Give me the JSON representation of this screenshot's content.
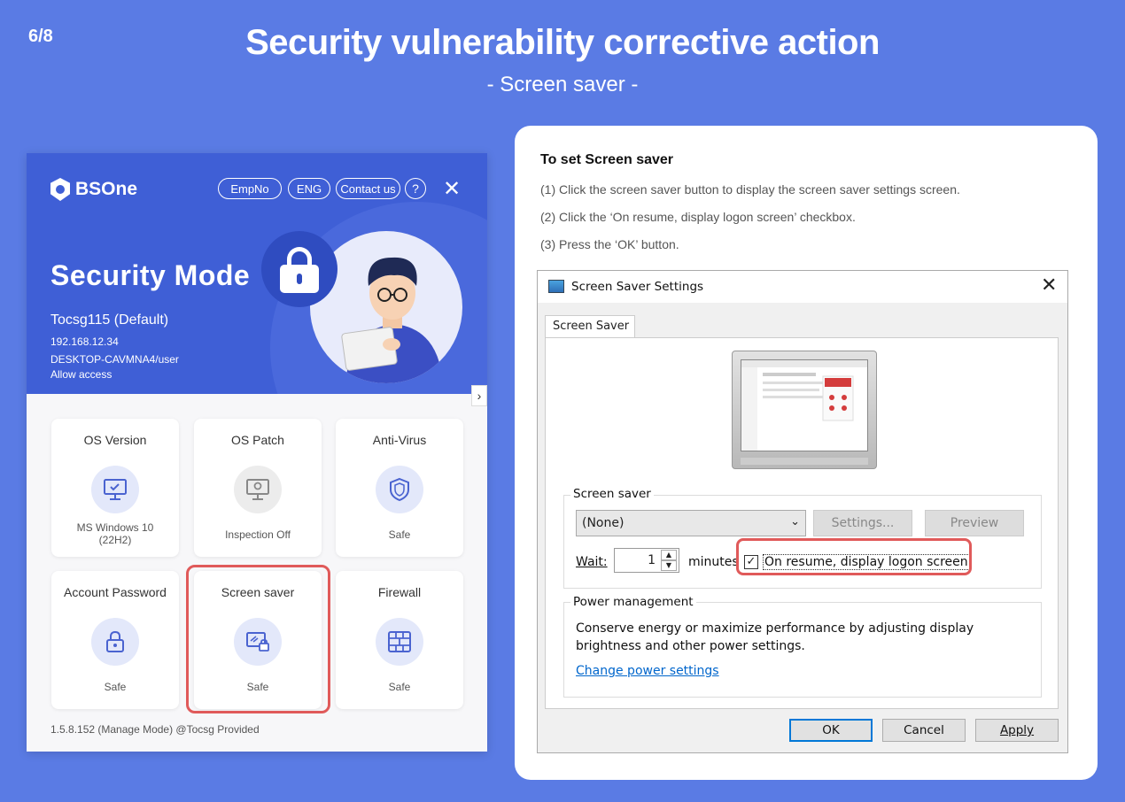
{
  "slide": {
    "page": "6/8",
    "title": "Security vulnerability corrective action",
    "subtitle": "- Screen saver -"
  },
  "app": {
    "brand": "BSOne",
    "header_buttons": [
      "EmpNo",
      "ENG",
      "Contact us"
    ],
    "help_label": "?",
    "close_label": "✕",
    "mode_title": "Security Mode",
    "user": "Tocsg115 (Default)",
    "ip": "192.168.12.34",
    "host": "DESKTOP-CAVMNA4/user",
    "access": "Allow access",
    "expand_label": "›",
    "cards": [
      {
        "title": "OS Version",
        "status": "MS Windows 10\n(22H2)",
        "icon": "monitor-check-icon"
      },
      {
        "title": "OS Patch",
        "status": "Inspection Off",
        "icon": "monitor-bulb-icon"
      },
      {
        "title": "Anti-Virus",
        "status": "Safe",
        "icon": "shield-icon"
      },
      {
        "title": "Account Password",
        "status": "Safe",
        "icon": "lock-icon"
      },
      {
        "title": "Screen saver",
        "status": "Safe",
        "icon": "screen-lock-icon"
      },
      {
        "title": "Firewall",
        "status": "Safe",
        "icon": "firewall-icon"
      }
    ],
    "footer": "1.5.8.152 (Manage Mode) @Tocsg Provided"
  },
  "instructions": {
    "title": "To set Screen saver",
    "steps": [
      "(1) Click the screen saver button to display the screen saver settings screen.",
      "(2) Click the ‘On resume, display logon screen’ checkbox.",
      "(3) Press the ‘OK’ button."
    ]
  },
  "dialog": {
    "title": "Screen Saver Settings",
    "tab": "Screen Saver",
    "screen_saver_group": "Screen saver",
    "saver_value": "(None)",
    "settings_button": "Settings...",
    "preview_button": "Preview",
    "wait_label": "Wait:",
    "wait_value": "1",
    "minutes_label": "minutes",
    "resume_checkbox_label": "On resume, display logon screen",
    "resume_checked": true,
    "power_group": "Power management",
    "power_text": "Conserve energy or maximize performance by adjusting display brightness and other power settings.",
    "power_link": "Change power settings",
    "ok_button": "OK",
    "cancel_button": "Cancel",
    "apply_button": "Apply"
  },
  "colors": {
    "background": "#5a7be4",
    "app_header": "#3f5fd6",
    "highlight": "#e05a5a",
    "link": "#0066cc"
  }
}
